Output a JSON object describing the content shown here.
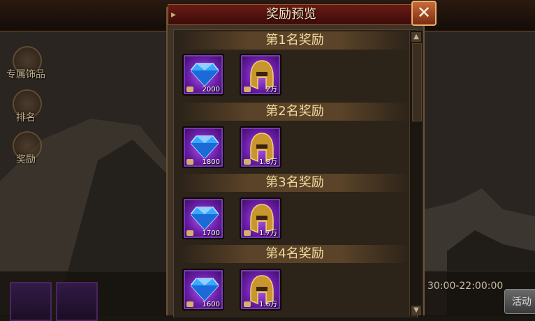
{
  "dialog": {
    "title": "奖励预览",
    "ranks": [
      {
        "label": "第1名奖励",
        "items": [
          {
            "icon": "blue-diamond-icon",
            "qty": "2000"
          },
          {
            "icon": "gold-helmet-icon",
            "qty": "2万"
          }
        ]
      },
      {
        "label": "第2名奖励",
        "items": [
          {
            "icon": "blue-diamond-icon",
            "qty": "1800"
          },
          {
            "icon": "gold-helmet-icon",
            "qty": "1.8万"
          }
        ]
      },
      {
        "label": "第3名奖励",
        "items": [
          {
            "icon": "blue-diamond-icon",
            "qty": "1700"
          },
          {
            "icon": "gold-helmet-icon",
            "qty": "1.7万"
          }
        ]
      },
      {
        "label": "第4名奖励",
        "items": [
          {
            "icon": "blue-diamond-icon",
            "qty": "1600"
          },
          {
            "icon": "gold-helmet-icon",
            "qty": "1.6万"
          }
        ]
      }
    ]
  },
  "side_menu": {
    "exclusive": "专属饰品",
    "ranking": "排名",
    "rewards": "奖励"
  },
  "bottom": {
    "time_text": "30:00-22:00:00",
    "activity_button": "活动"
  },
  "colors": {
    "title_bar": "#6a1a14",
    "item_rarity_purple": "#7a3ab0",
    "header_text": "#f0d89c"
  }
}
